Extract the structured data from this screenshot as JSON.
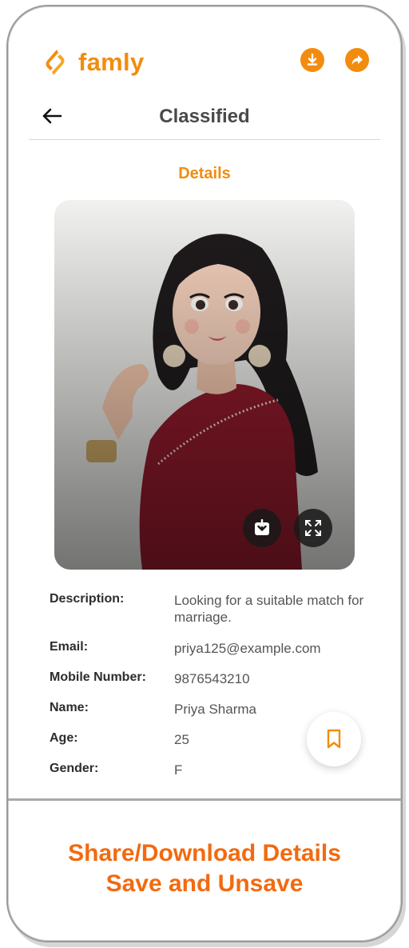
{
  "app": {
    "brand_name": "famly",
    "accent_color": "#f28c0f"
  },
  "toolbar": {
    "download_icon": "download-icon",
    "share_icon": "share-icon"
  },
  "header": {
    "title": "Classified",
    "back_icon": "arrow-left-icon"
  },
  "section": {
    "title": "Details"
  },
  "photo": {
    "subject": "illustration-woman-red-saree",
    "actions": [
      "download-icon",
      "fullscreen-icon"
    ]
  },
  "details": {
    "description_label": "Description:",
    "description_value": "Looking for a suitable match for marriage.",
    "email_label": "Email:",
    "email_value": "priya125@example.com",
    "mobile_label": "Mobile Number:",
    "mobile_value": "9876543210",
    "name_label": "Name:",
    "name_value": "Priya Sharma",
    "age_label": "Age:",
    "age_value": "25",
    "gender_label": "Gender:",
    "gender_value": "F"
  },
  "bookmark": {
    "icon": "bookmark-icon"
  },
  "caption": {
    "line1": "Share/Download Details",
    "line2": "Save and Unsave",
    "color": "#f26a10"
  }
}
